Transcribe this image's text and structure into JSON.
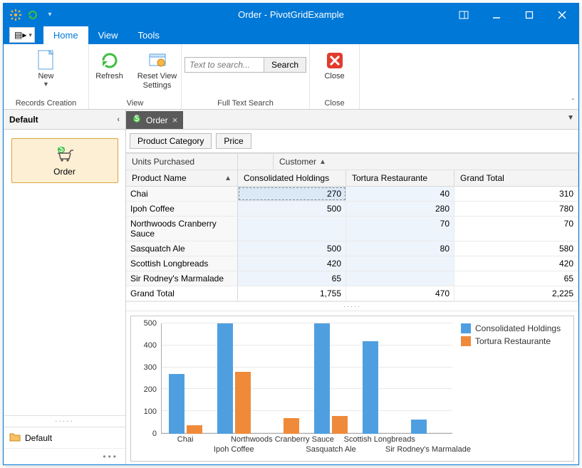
{
  "window": {
    "title": "Order - PivotGridExample"
  },
  "qat": {
    "dropdown": "▾"
  },
  "nav_switcher": {
    "glyph": "▤▸",
    "dropdown": "▾"
  },
  "tabs": {
    "home": "Home",
    "view": "View",
    "tools": "Tools"
  },
  "ribbon": {
    "records_creation": {
      "label": "Records Creation",
      "new": "New"
    },
    "view": {
      "label": "View",
      "refresh": "Refresh",
      "reset": "Reset View Settings"
    },
    "search": {
      "label": "Full Text Search",
      "placeholder": "Text to search...",
      "button": "Search"
    },
    "close": {
      "label": "Close",
      "button": "Close"
    }
  },
  "sidebar": {
    "header": "Default",
    "item": "Order",
    "footer": "Default"
  },
  "doctab": {
    "title": "Order"
  },
  "pivot": {
    "filter_fields": [
      "Product Category",
      "Price"
    ],
    "data_field": "Units Purchased",
    "column_field": "Customer",
    "row_field": "Product Name",
    "columns": [
      "Consolidated Holdings",
      "Tortura Restaurante",
      "Grand Total"
    ],
    "rows": [
      {
        "label": "Chai",
        "cells": [
          "270",
          "40",
          "310"
        ]
      },
      {
        "label": "Ipoh Coffee",
        "cells": [
          "500",
          "280",
          "780"
        ]
      },
      {
        "label": "Northwoods Cranberry Sauce",
        "cells": [
          "",
          "70",
          "70"
        ]
      },
      {
        "label": "Sasquatch Ale",
        "cells": [
          "500",
          "80",
          "580"
        ]
      },
      {
        "label": "Scottish Longbreads",
        "cells": [
          "420",
          "",
          "420"
        ]
      },
      {
        "label": "Sir Rodney's Marmalade",
        "cells": [
          "65",
          "",
          "65"
        ]
      }
    ],
    "total_row": {
      "label": "Grand Total",
      "cells": [
        "1,755",
        "470",
        "2,225"
      ]
    }
  },
  "chart_data": {
    "type": "bar",
    "categories": [
      "Chai",
      "Ipoh Coffee",
      "Northwoods Cranberry Sauce",
      "Sasquatch Ale",
      "Scottish Longbreads",
      "Sir Rodney's Marmalade"
    ],
    "series": [
      {
        "name": "Consolidated Holdings",
        "values": [
          270,
          500,
          0,
          500,
          420,
          65
        ]
      },
      {
        "name": "Tortura Restaurante",
        "values": [
          40,
          280,
          70,
          80,
          0,
          0
        ]
      }
    ],
    "ylim": [
      0,
      500
    ],
    "yticks": [
      0,
      100,
      200,
      300,
      400,
      500
    ],
    "xlabel": "",
    "ylabel": "",
    "title": ""
  }
}
